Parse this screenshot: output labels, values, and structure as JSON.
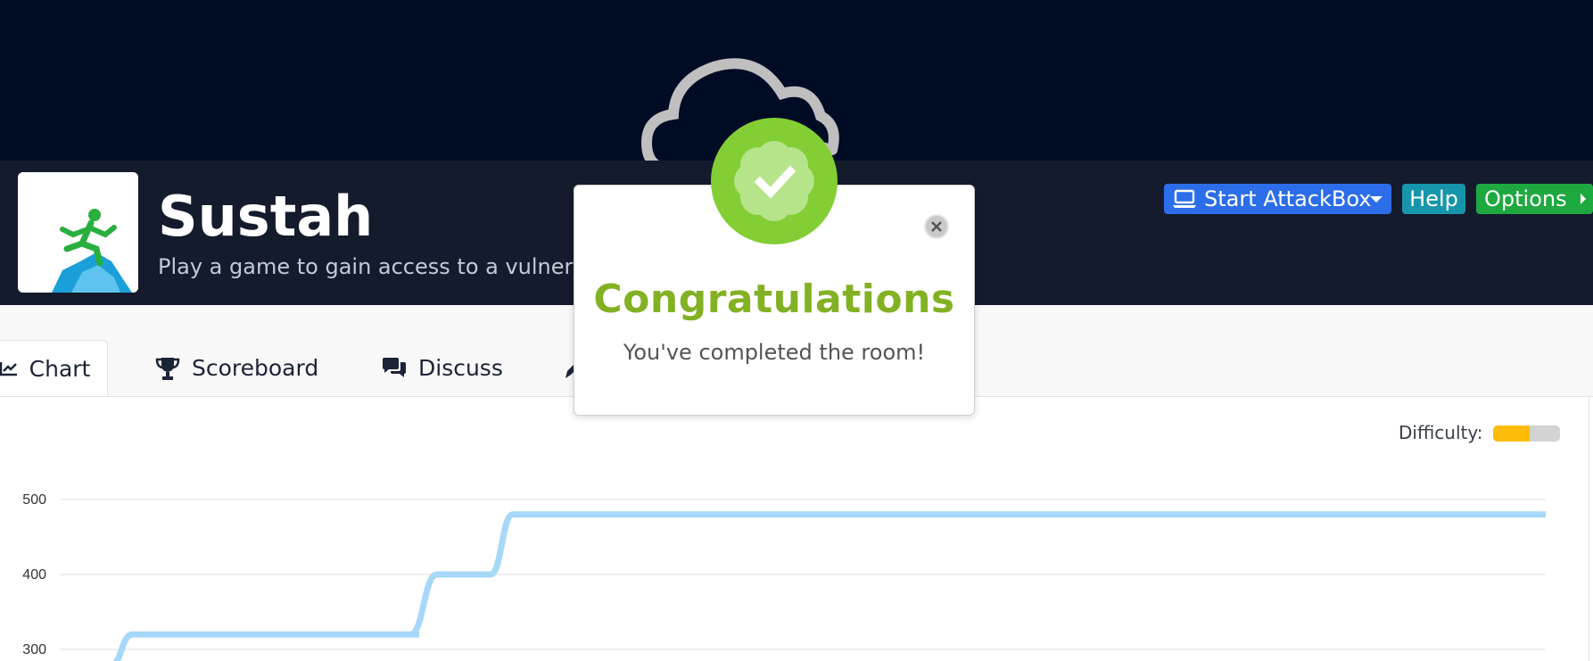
{
  "room": {
    "title": "Sustah",
    "description": "Play a game to gain access to a vulnerabl"
  },
  "actions": {
    "start_attackbox": "Start AttackBox",
    "help": "Help",
    "options": "Options"
  },
  "tabs": [
    {
      "label": "Chart",
      "icon": "chart-line-icon",
      "active": true
    },
    {
      "label": "Scoreboard",
      "icon": "trophy-icon"
    },
    {
      "label": "Discuss",
      "icon": "comments-icon"
    }
  ],
  "difficulty": {
    "label": "Difficulty:",
    "level": 0.55,
    "color": "#fdbc0a"
  },
  "chart_data": {
    "type": "line",
    "title": "",
    "xlabel": "",
    "ylabel": "",
    "y_ticks": [
      300,
      400,
      500
    ],
    "ylim": [
      290,
      510
    ],
    "x": [
      0,
      1,
      2,
      3,
      4,
      5,
      6,
      7,
      8,
      9,
      10,
      11,
      12,
      13,
      14,
      15,
      16,
      17,
      18,
      19,
      20
    ],
    "series": [
      {
        "name": "",
        "color": "#a6d8f7",
        "values": [
          280,
          320,
          320,
          320,
          320,
          320,
          320,
          400,
          400,
          480,
          480,
          480,
          480,
          480,
          480,
          480,
          480,
          480,
          480,
          480,
          480
        ]
      }
    ],
    "grid": true
  },
  "modal": {
    "title": "Congratulations",
    "message": "You've completed the room!"
  },
  "colors": {
    "banner": "#000b24",
    "header": "#141b2c",
    "accent_green": "#82ce34",
    "title_green": "#83b124"
  }
}
